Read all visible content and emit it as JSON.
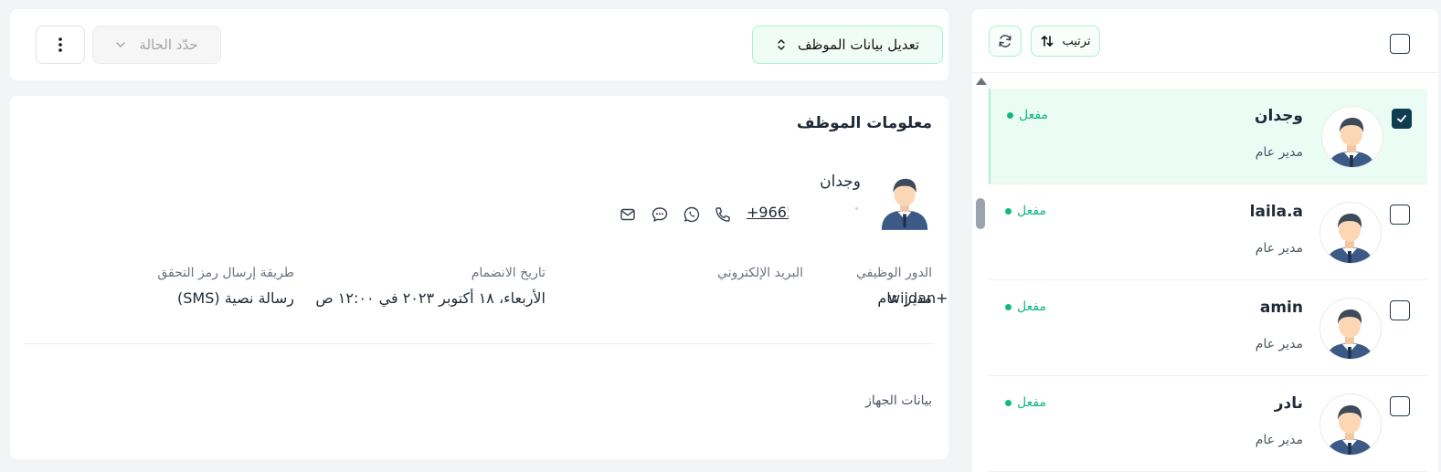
{
  "toolbar": {
    "edit_label": "تعديل بيانات الموظف",
    "status_placeholder": "حدّد الحالة"
  },
  "employee_info": {
    "section_title": "معلومات الموظف",
    "name": "وجدان",
    "phone": "+9665",
    "fields": [
      {
        "label": "الدور الوظيفي",
        "value": "مدير عام"
      },
      {
        "label": "البريد الإلكتروني",
        "value": "wijdan+"
      },
      {
        "label": "تاريخ الانضمام",
        "value": "الأربعاء، ١٨ أكتوبر ٢٠٢٣ في ١٢:٠٠ ص"
      },
      {
        "label": "طريقة إرسال رمز التحقق",
        "value": "رسالة نصية (SMS)"
      }
    ],
    "device_section_label": "بيانات الجهاز"
  },
  "list": {
    "sort_label": "ترتيب",
    "employees": [
      {
        "name": "وجدان",
        "role": "مدير عام",
        "status": "مفعل",
        "selected": true
      },
      {
        "name": "laila.a",
        "role": "مدير عام",
        "status": "مفعل",
        "selected": false
      },
      {
        "name": "amin",
        "role": "مدير عام",
        "status": "مفعل",
        "selected": false
      },
      {
        "name": "نادر",
        "role": "مدير عام",
        "status": "مفعل",
        "selected": false
      }
    ]
  },
  "icons": {
    "contact": [
      "email-icon",
      "sms-icon",
      "whatsapp-icon",
      "phone-icon"
    ]
  },
  "colors": {
    "accent": "#10b981",
    "accent_border": "#a7f3d0",
    "selected_row_bg": "#ebfcf5",
    "checkbox_checked": "#0f3d4f"
  }
}
